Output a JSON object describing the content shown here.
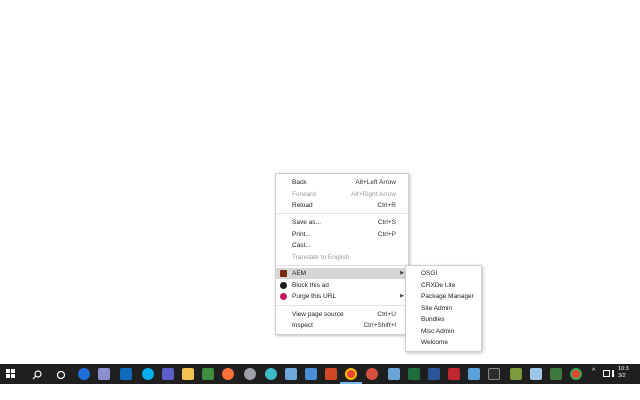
{
  "context_menu": {
    "items": [
      {
        "label": "Back",
        "shortcut": "Alt+Left Arrow",
        "disabled": false
      },
      {
        "label": "Forward",
        "shortcut": "Alt+Right Arrow",
        "disabled": true
      },
      {
        "label": "Reload",
        "shortcut": "Ctrl+R",
        "disabled": false
      },
      {
        "label": "Save as...",
        "shortcut": "Ctrl+S",
        "disabled": false
      },
      {
        "label": "Print...",
        "shortcut": "Ctrl+P",
        "disabled": false
      },
      {
        "label": "Cast...",
        "shortcut": "",
        "disabled": false
      },
      {
        "label": "Translate to English",
        "shortcut": "",
        "disabled": true
      },
      {
        "label": "AEM",
        "shortcut": "",
        "disabled": false,
        "icon": "aem-extension-icon",
        "color": "#7a2a10"
      },
      {
        "label": "Block this ad",
        "shortcut": "",
        "disabled": false,
        "icon": "adblock-shield-icon",
        "color": "#1a1a1a"
      },
      {
        "label": "Purge this URL",
        "shortcut": "",
        "disabled": false,
        "icon": "purge-url-icon",
        "color": "#c2185b"
      },
      {
        "label": "View page source",
        "shortcut": "Ctrl+U",
        "disabled": false
      },
      {
        "label": "Inspect",
        "shortcut": "Ctrl+Shift+I",
        "disabled": false
      }
    ]
  },
  "aem_submenu": {
    "items": [
      "OSGI",
      "CRXDe Lite",
      "Package Manager",
      "Site Admin",
      "Bundles",
      "Misc Admin",
      "Welcome"
    ]
  },
  "taskbar": {
    "clock_time": "10:3",
    "clock_date": "3/2",
    "accent": "#76b9ed"
  }
}
